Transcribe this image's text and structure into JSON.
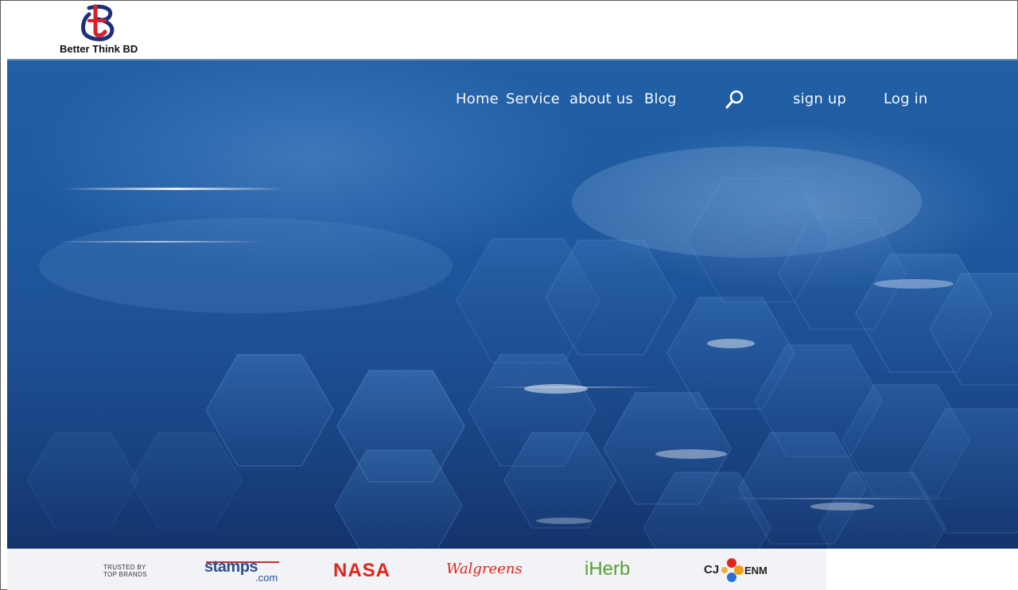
{
  "logo": {
    "text": "Better Think BD",
    "icon": "bt-logo-icon"
  },
  "nav": {
    "home": "Home",
    "service": "Service",
    "about": "about us",
    "blog": "Blog",
    "search_icon": "search-icon",
    "signup": "sign up",
    "login": "Log in"
  },
  "trusted": {
    "line1": "TRUSTED BY",
    "line2": "TOP BRANDS"
  },
  "brands": {
    "stamps_main": "stamps",
    "stamps_sub": ".com",
    "nasa": "NASA",
    "walgreens": "Walgreens",
    "iherb": "iHerb",
    "cj": "CJ",
    "enm": "ENM"
  },
  "colors": {
    "hero_blue": "#1f5aa0",
    "nav_text": "#f4f7fc",
    "nasa_red": "#e2231a",
    "iherb_green": "#56a131",
    "stamps_blue": "#2a4f96"
  }
}
